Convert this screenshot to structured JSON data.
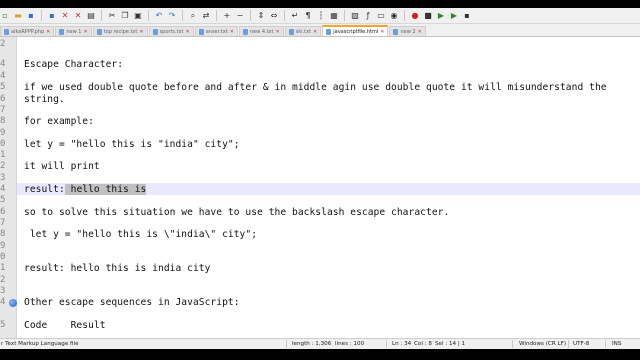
{
  "toolbar": {
    "icons": [
      "new-file-icon",
      "open-folder-icon",
      "save-icon",
      "save-all-icon",
      "close-icon",
      "close-all-icon",
      "print-icon",
      "cut-icon",
      "copy-icon",
      "paste-icon",
      "undo-icon",
      "redo-icon",
      "find-icon",
      "replace-icon",
      "zoom-in-icon",
      "zoom-out-icon",
      "sync-vertical-icon",
      "sync-horizontal-icon",
      "word-wrap-icon",
      "show-all-chars-icon",
      "indent-guide-icon",
      "udl-icon",
      "doc-map-icon",
      "function-list-icon",
      "folder-workspace-icon",
      "monitor-icon",
      "record-macro-icon",
      "stop-record-icon",
      "play-macro-icon",
      "run-macro-multiple-icon",
      "save-macro-icon"
    ]
  },
  "tabs": [
    {
      "label": "alkaRPPP.php"
    },
    {
      "label": "new 1"
    },
    {
      "label": "top recipe.txt"
    },
    {
      "label": "sports.txt"
    },
    {
      "label": "anser.txt"
    },
    {
      "label": "new 4.txt"
    },
    {
      "label": "ski.txt"
    },
    {
      "label": "javascriptfile.html",
      "active": true
    },
    {
      "label": "new 2"
    }
  ],
  "gutter": {
    "line_numbers": [
      "2",
      "4",
      "4",
      "5",
      "6",
      "7",
      "8",
      "9",
      "0",
      "1",
      "2",
      "3",
      "4",
      "5",
      "6",
      "7",
      "8",
      "9",
      "0",
      "1",
      "2",
      "3",
      "4",
      "5"
    ]
  },
  "editor_lines": {
    "l1": "Escape Character:",
    "l2": "if we used double quote before and after & in middle agin use double quote it will misunderstand the",
    "l3": "string.",
    "l4": "for example:",
    "l5": "let y = \"hello this is \"india\" city\";",
    "l6": "it will print",
    "l7_prefix": "result:",
    "l7_selected": " hello this is",
    "l8": "so to solve this situation we have to use the backslash escape character.",
    "l9": " let y = \"hello this is \\\"india\\\" city\";",
    "l10": "result: hello this is india city",
    "l11": "Other escape sequences in JavaScript:",
    "l12": "Code    Result"
  },
  "status": {
    "file_type": "r Text Markup Language file",
    "length": "length : 1,306",
    "lines": "lines : 100",
    "ln": "Ln : 34",
    "col": "Col : 8",
    "sel": "Sel : 14 | 1",
    "eol": "Windows (CR LF)",
    "encoding": "UTF-8",
    "mode": "INS"
  },
  "colors": {
    "active_tab_accent": "#f5a623",
    "current_line_bg": "#e8e8ff",
    "bookmark": "#1f5fcf"
  }
}
